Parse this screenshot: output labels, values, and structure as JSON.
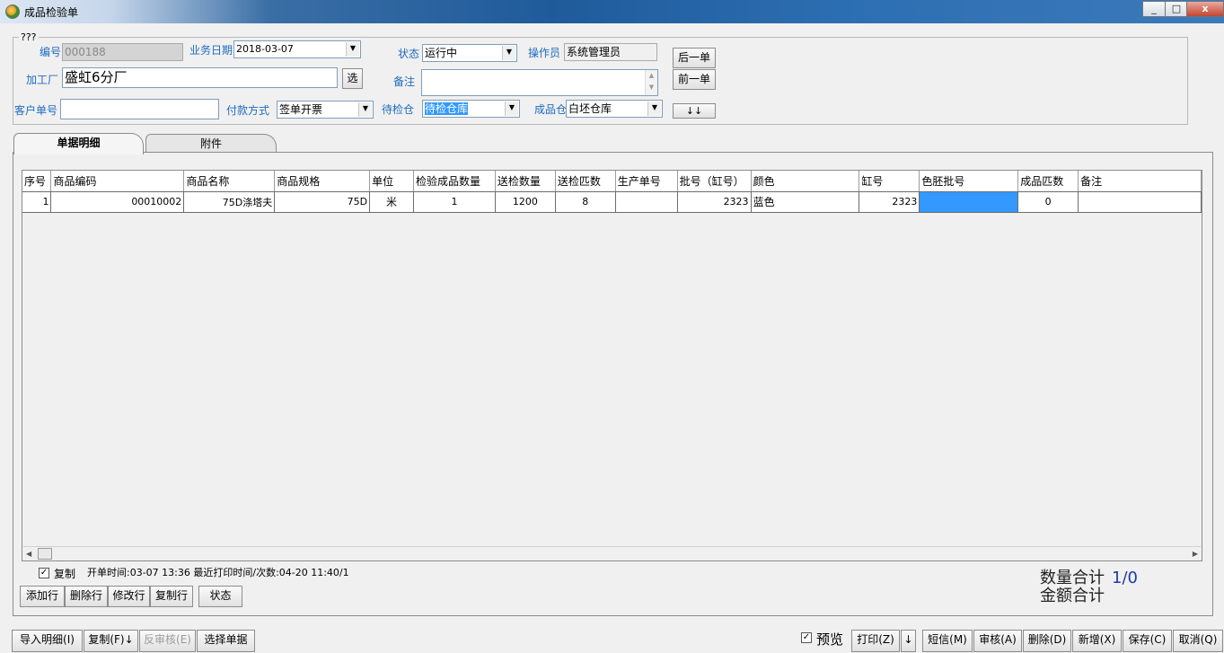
{
  "window": {
    "title": "成品检验单",
    "min": "_",
    "max": "□",
    "close": "x"
  },
  "group_title": "???",
  "form": {
    "no_label": "编号",
    "no_value": "000188",
    "date_label": "业务日期",
    "date_value": "2018-03-07",
    "status_label": "状态",
    "status_value": "运行中",
    "operator_label": "操作员",
    "operator_value": "系统管理员",
    "factory_label": "加工厂",
    "factory_value": "盛虹6分厂",
    "factory_pick": "选",
    "remark_label": "备注",
    "remark_value": "",
    "customer_no_label": "客户单号",
    "customer_no_value": "",
    "payment_label": "付款方式",
    "payment_value": "签单开票",
    "pending_wh_label": "待检仓",
    "pending_wh_value": "待检仓库",
    "finished_wh_label": "成品仓",
    "finished_wh_value": "白坯仓库",
    "next_btn": "后一单",
    "prev_btn": "前一单",
    "down_btn": "↓↓"
  },
  "tabs": [
    {
      "label": "单据明细"
    },
    {
      "label": "附件"
    }
  ],
  "grid": {
    "columns": [
      "序号",
      "商品编码",
      "商品名称",
      "商品规格",
      "单位",
      "检验成品数量",
      "送检数量",
      "送检匹数",
      "生产单号",
      "批号（缸号）",
      "颜色",
      "缸号",
      "色胚批号",
      "成品匹数",
      "备注"
    ],
    "rows": [
      [
        "1",
        "00010002",
        "75D涤塔夫",
        "75D",
        "米",
        "1",
        "1200",
        "8",
        "",
        "2323",
        "蓝色",
        "2323",
        "",
        "0",
        ""
      ]
    ]
  },
  "copy_check_label": "复制",
  "info_text": "开单时间:03-07 13:36 最近打印时间/次数:04-20 11:40/1",
  "row_buttons": [
    "添加行",
    "删除行",
    "修改行",
    "复制行",
    "状态"
  ],
  "totals": {
    "qty_label": "数量合计",
    "qty_value": "1/0",
    "amount_label": "金额合计"
  },
  "bottom_left_buttons": [
    {
      "label": "导入明细(I)",
      "disabled": false
    },
    {
      "label": "复制(F)↓",
      "disabled": false
    },
    {
      "label": "反审核(E)",
      "disabled": true
    },
    {
      "label": "选择单据",
      "disabled": false
    }
  ],
  "preview_label": "预览",
  "print_button": "打印(Z)",
  "print_arrow": "↓",
  "bottom_right_buttons": [
    "短信(M)",
    "审核(A)",
    "删除(D)",
    "新增(X)",
    "保存(C)",
    "取消(Q)"
  ],
  "colors": {
    "label_blue": "#1e6bbf",
    "selected_cell": "#3399ff",
    "totals_value": "#1a3aa8"
  }
}
